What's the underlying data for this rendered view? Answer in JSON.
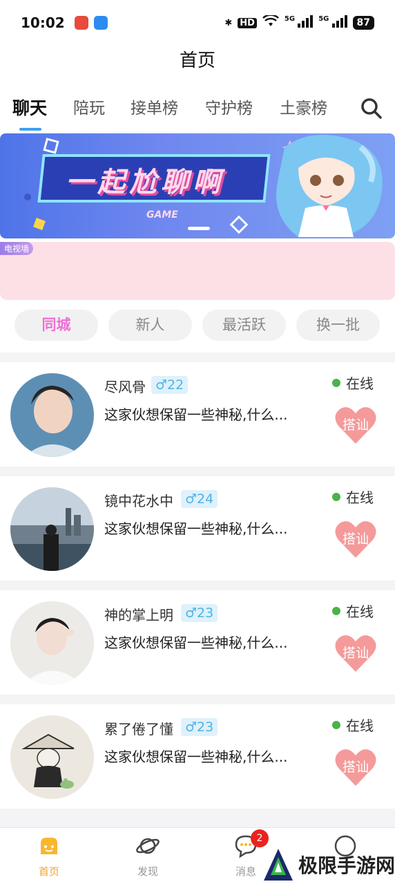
{
  "status_bar": {
    "time": "10:02",
    "hd_label": "HD",
    "net_label_1": "5G",
    "net_label_2": "5G",
    "battery": "87"
  },
  "header": {
    "title": "首页"
  },
  "tabs": [
    {
      "label": "聊天",
      "active": true
    },
    {
      "label": "陪玩"
    },
    {
      "label": "接单榜"
    },
    {
      "label": "守护榜"
    },
    {
      "label": "土豪榜"
    }
  ],
  "banner": {
    "headline": "一起尬聊啊",
    "sub": "GAME"
  },
  "tv_wall": {
    "tag": "电视墙"
  },
  "filters": [
    {
      "label": "同城",
      "active": true
    },
    {
      "label": "新人"
    },
    {
      "label": "最活跃"
    },
    {
      "label": "换一批"
    }
  ],
  "users": [
    {
      "name": "尽风骨",
      "gender_age": "♂22",
      "bio": "这家伙想保留一些神秘,什么...",
      "status": "在线",
      "action": "搭讪"
    },
    {
      "name": "镜中花水中",
      "gender_age": "♂24",
      "bio": "这家伙想保留一些神秘,什么...",
      "status": "在线",
      "action": "搭讪"
    },
    {
      "name": "神的掌上明",
      "gender_age": "♂23",
      "bio": "这家伙想保留一些神秘,什么...",
      "status": "在线",
      "action": "搭讪"
    },
    {
      "name": "累了倦了懂",
      "gender_age": "♂23",
      "bio": "这家伙想保留一些神秘,什么...",
      "status": "在线",
      "action": "搭讪"
    }
  ],
  "bottom_nav": [
    {
      "label": "首页",
      "icon": "home-icon",
      "active": true
    },
    {
      "label": "发现",
      "icon": "planet-icon"
    },
    {
      "label": "消息",
      "icon": "chat-bubble-icon",
      "badge": "2"
    },
    {
      "label": "",
      "icon": "profile-icon"
    }
  ],
  "watermark": {
    "text": "极限手游网"
  },
  "colors": {
    "accent": "#3aa0ee",
    "filter_active": "#ef6fd2",
    "online": "#4bb249",
    "greet_heart": "#f59a9a",
    "nav_active": "#f2a62c",
    "badge": "#e9241e"
  }
}
